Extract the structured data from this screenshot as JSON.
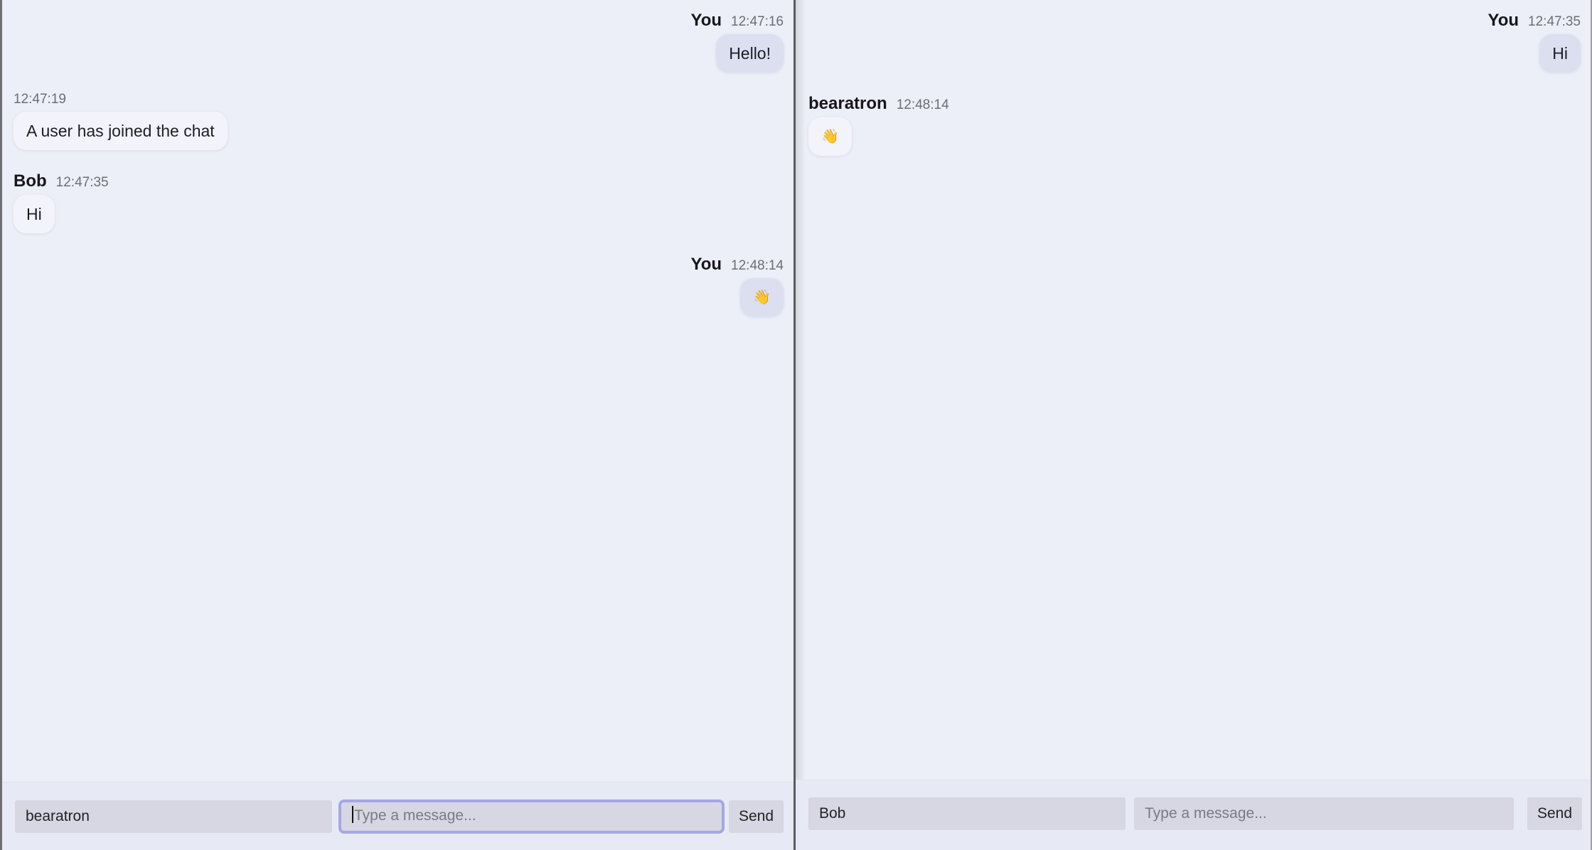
{
  "left": {
    "messages": [
      {
        "kind": "mine",
        "sender": "You",
        "time": "12:47:16",
        "text": "Hello!"
      },
      {
        "kind": "system",
        "time": "12:47:19",
        "text": "A user has joined the chat"
      },
      {
        "kind": "theirs",
        "sender": "Bob",
        "time": "12:47:35",
        "text": "Hi"
      },
      {
        "kind": "mine",
        "sender": "You",
        "time": "12:48:14",
        "text": "👋"
      }
    ],
    "composer": {
      "username": "bearatron",
      "message_placeholder": "Type a message...",
      "send_label": "Send"
    }
  },
  "right": {
    "messages": [
      {
        "kind": "mine",
        "sender": "You",
        "time": "12:47:35",
        "text": "Hi"
      },
      {
        "kind": "theirs",
        "sender": "bearatron",
        "time": "12:48:14",
        "text": "👋"
      }
    ],
    "composer": {
      "username": "Bob",
      "message_placeholder": "Type a message...",
      "send_label": "Send"
    }
  },
  "colors": {
    "background": "#eceef8",
    "bubble_theirs": "#f3f4fb",
    "bubble_mine": "#dcdff0",
    "input_bg": "#d6d7e2",
    "focus_ring": "#a5a6e6"
  }
}
